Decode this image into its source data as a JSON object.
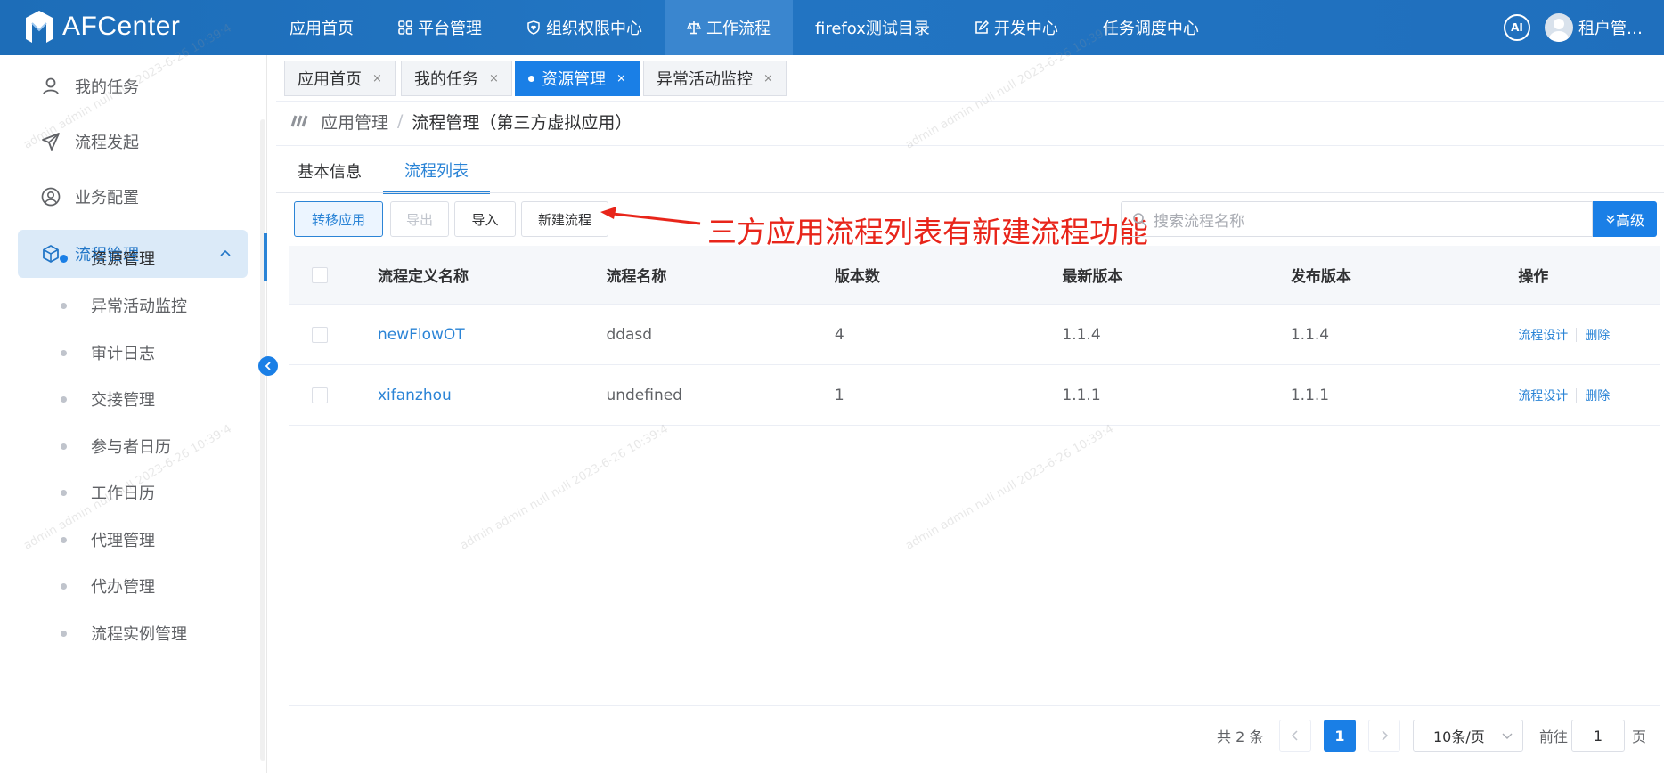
{
  "header": {
    "app_name": "AFCenter",
    "nav": [
      {
        "label": "应用首页",
        "icon": ""
      },
      {
        "label": "平台管理",
        "icon": "grid-icon"
      },
      {
        "label": "组织权限中心",
        "icon": "shield-heart-icon"
      },
      {
        "label": "工作流程",
        "icon": "scale-icon"
      },
      {
        "label": "firefox测试目录",
        "icon": ""
      },
      {
        "label": "开发中心",
        "icon": "edit-icon"
      },
      {
        "label": "任务调度中心",
        "icon": ""
      }
    ],
    "active_nav_index": 3,
    "ai_label": "AI",
    "user_name": "租户管…"
  },
  "sidebar": {
    "items": [
      {
        "label": "我的任务",
        "icon": "user-icon"
      },
      {
        "label": "流程发起",
        "icon": "send-icon"
      },
      {
        "label": "业务配置",
        "icon": "user-circle-icon"
      }
    ],
    "group": {
      "label": "流程管理",
      "icon": "cube-icon",
      "expanded": true
    },
    "sub_items": [
      "资源管理",
      "异常活动监控",
      "审计日志",
      "交接管理",
      "参与者日历",
      "工作日历",
      "代理管理",
      "代办管理",
      "流程实例管理"
    ],
    "active_sub_index": 0
  },
  "tabs": [
    {
      "label": "应用首页",
      "close": "×"
    },
    {
      "label": "我的任务",
      "close": "×"
    },
    {
      "label": "资源管理",
      "close": "×"
    },
    {
      "label": "异常活动监控",
      "close": "×"
    }
  ],
  "active_tab_index": 2,
  "breadcrumb": {
    "parent": "应用管理",
    "separator": "/",
    "current": "流程管理（第三方虚拟应用）"
  },
  "subtabs": [
    "基本信息",
    "流程列表"
  ],
  "active_subtab_index": 1,
  "toolbar": {
    "transfer": "转移应用",
    "export": "导出",
    "import": "导入",
    "new_flow": "新建流程",
    "search_placeholder": "搜索流程名称",
    "advanced": "高级"
  },
  "annotation": "三方应用流程列表有新建流程功能",
  "table": {
    "headers": [
      "流程定义名称",
      "流程名称",
      "版本数",
      "最新版本",
      "发布版本",
      "操作"
    ],
    "rows": [
      {
        "def_name": "newFlowOT",
        "name": "ddasd",
        "versions": "4",
        "latest": "1.1.4",
        "published": "1.1.4"
      },
      {
        "def_name": "xifanzhou",
        "name": "undefined",
        "versions": "1",
        "latest": "1.1.1",
        "published": "1.1.1"
      }
    ],
    "actions": [
      "流程设计",
      "删除"
    ]
  },
  "pagination": {
    "total_text": "共 2 条",
    "current_page": "1",
    "page_size": "10条/页",
    "goto_label": "前往",
    "goto_value": "1",
    "page_suffix": "页"
  },
  "watermark": "admin admin null null 2023-6-26 10:39:4",
  "colors": {
    "primary": "#1a7fe6",
    "header": "#1f6fbd",
    "annotation": "#e8251a"
  }
}
